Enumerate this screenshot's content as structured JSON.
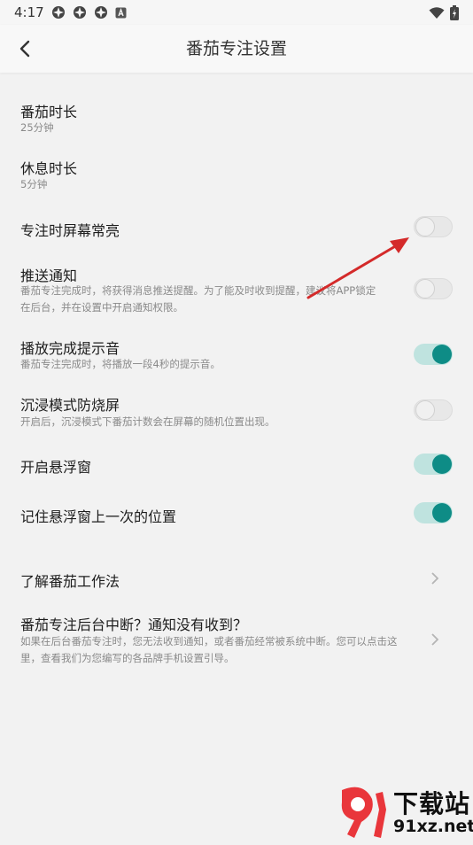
{
  "status_bar": {
    "time": "4:17"
  },
  "appbar": {
    "title": "番茄专注设置"
  },
  "settings": [
    {
      "title": "番茄时长",
      "subtitle": "25分钟"
    },
    {
      "title": "休息时长",
      "subtitle": "5分钟"
    },
    {
      "title": "专注时屏幕常亮",
      "toggle": false
    },
    {
      "title": "推送通知",
      "subtitle": "番茄专注完成时，将获得消息推送提醒。为了能及时收到提醒，建议将APP锁定在后台，并在设置中开启通知权限。",
      "toggle": false
    },
    {
      "title": "播放完成提示音",
      "subtitle": "番茄专注完成时，将播放一段4秒的提示音。",
      "toggle": true
    },
    {
      "title": "沉浸模式防烧屏",
      "subtitle": "开启后，沉浸模式下番茄计数会在屏幕的随机位置出现。",
      "toggle": false
    },
    {
      "title": "开启悬浮窗",
      "toggle": true
    },
    {
      "title": "记住悬浮窗上一次的位置",
      "toggle": true
    }
  ],
  "links": [
    {
      "title": "了解番茄工作法"
    },
    {
      "title": "番茄专注后台中断？通知没有收到？",
      "subtitle": "如果在后台番茄专注时，您无法收到通知，或者番茄经常被系统中断。您可以点击这里，查看我们为您编写的各品牌手机设置引导。"
    }
  ],
  "watermark": {
    "text1": "下载站",
    "text2": "91xz.net"
  },
  "colors": {
    "accent": "#0e8c86",
    "accent_track": "#bfe3df",
    "annotation_arrow": "#d42a2a"
  }
}
